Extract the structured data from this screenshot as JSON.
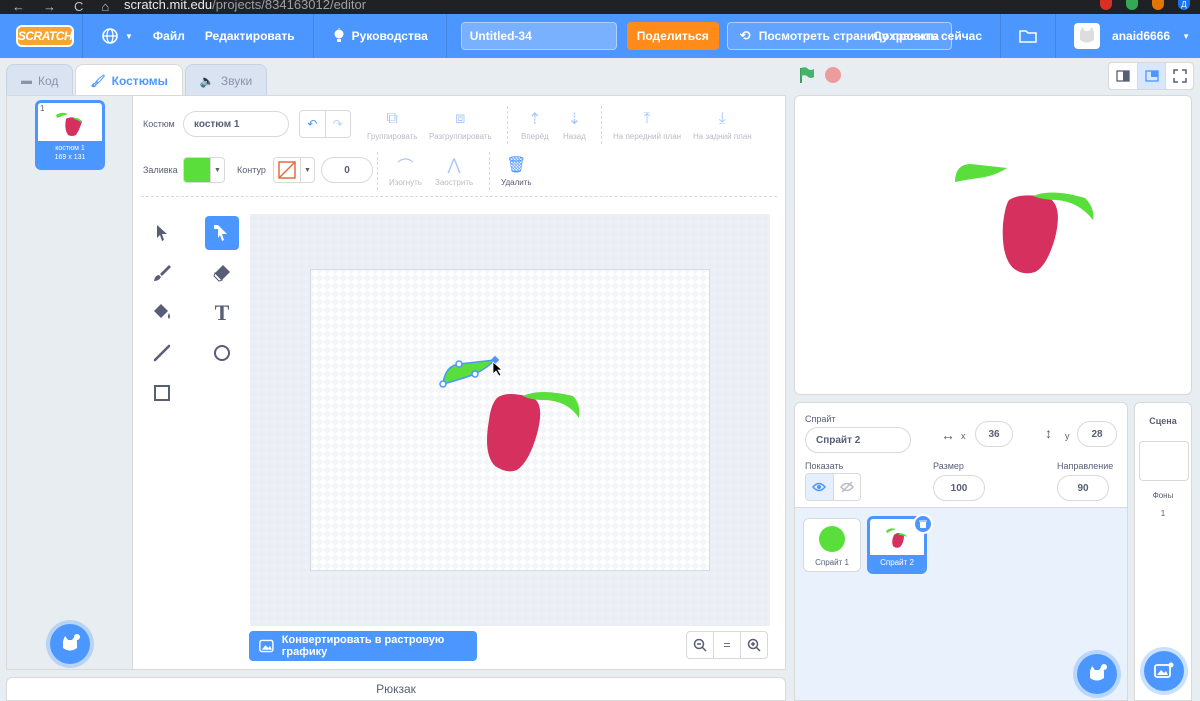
{
  "browser": {
    "nav_back": "←",
    "nav_forward": "→",
    "nav_reload": "C",
    "nav_home": "⌂",
    "url_host": "scratch.mit.edu",
    "url_path": "/projects/834163012/editor",
    "profile_initial": "Д"
  },
  "menu": {
    "logo": "SCRATCH",
    "file": "Файл",
    "edit": "Редактировать",
    "tutorials": "Руководства",
    "project_title": "Untitled-34",
    "share": "Поделиться",
    "see_project_page": "Посмотреть страницу проекта",
    "save_now": "Сохранить сейчас",
    "username": "anaid6666"
  },
  "tabs": {
    "code": "Код",
    "costumes": "Костюмы",
    "sounds": "Звуки"
  },
  "costume_list": {
    "items": [
      {
        "number": "1",
        "name": "костюм 1",
        "size": "169 x 131"
      }
    ]
  },
  "paint": {
    "costume_label": "Костюм",
    "costume_name": "костюм 1",
    "group": "Группировать",
    "ungroup": "Разгруппировать",
    "forward": "Вперёд",
    "backward": "Назад",
    "front": "На передний план",
    "back": "На задний план",
    "fill_label": "Заливка",
    "fill_color": "#59de3c",
    "outline_label": "Контур",
    "outline_width": "0",
    "reshape": "Изогнуть",
    "pointed": "Заострить",
    "delete": "Удалить",
    "convert_bitmap": "Конвертировать в растровую графику",
    "zoom_out": "−",
    "zoom_reset": "=",
    "zoom_in": "+"
  },
  "tools": {
    "select": "select-arrow",
    "reshape": "reshape-arrow",
    "brush": "brush",
    "eraser": "eraser",
    "fill": "fill-bucket",
    "text": "T",
    "line": "line",
    "circle": "circle",
    "rect": "rectangle"
  },
  "backpack": "Рюкзак",
  "sprite_info": {
    "sprite_label": "Спрайт",
    "sprite_name": "Спрайт 2",
    "x_label": "x",
    "x_value": "36",
    "y_label": "y",
    "y_value": "28",
    "show_label": "Показать",
    "size_label": "Размер",
    "size_value": "100",
    "direction_label": "Направление",
    "direction_value": "90"
  },
  "sprites": [
    {
      "name": "Спрайт 1",
      "selected": false
    },
    {
      "name": "Спрайт 2",
      "selected": true
    }
  ],
  "stage_pane": {
    "title": "Сцена",
    "backdrops_label": "Фоны",
    "backdrops_count": "1"
  },
  "colors": {
    "accent": "#4c97ff",
    "share": "#ff8c1a",
    "apple_red": "#d6305e",
    "leaf_green": "#59de3c"
  }
}
